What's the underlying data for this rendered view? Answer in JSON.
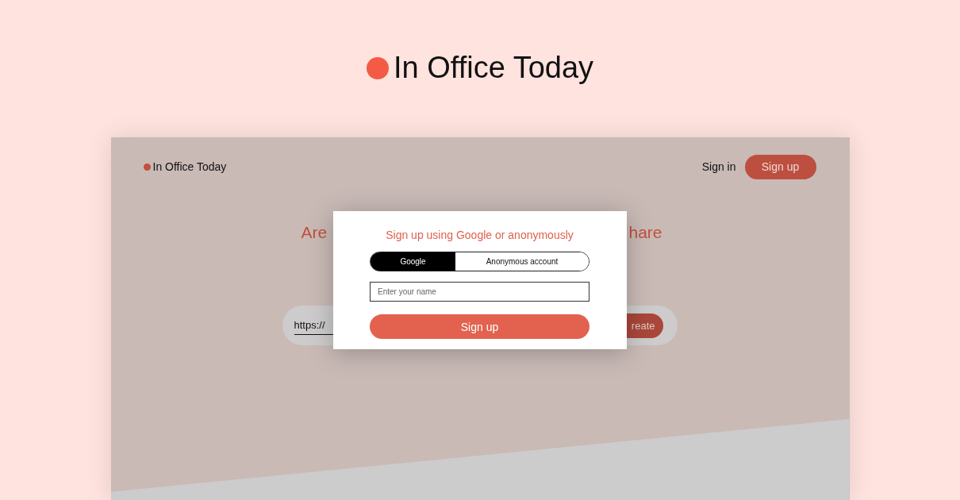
{
  "page_title": "In Office Today",
  "app": {
    "brand": "In Office Today",
    "sign_in": "Sign in",
    "sign_up": "Sign up",
    "headline_left": "Are",
    "headline_right": "hare",
    "url_field": {
      "value": "https://"
    },
    "create_button": "reate"
  },
  "modal": {
    "title": "Sign up using Google or anonymously",
    "tabs": [
      {
        "label": "Google",
        "selected": true
      },
      {
        "label": "Anonymous account",
        "selected": false
      }
    ],
    "name_field": {
      "placeholder": "Enter your name"
    },
    "submit": "Sign up"
  }
}
